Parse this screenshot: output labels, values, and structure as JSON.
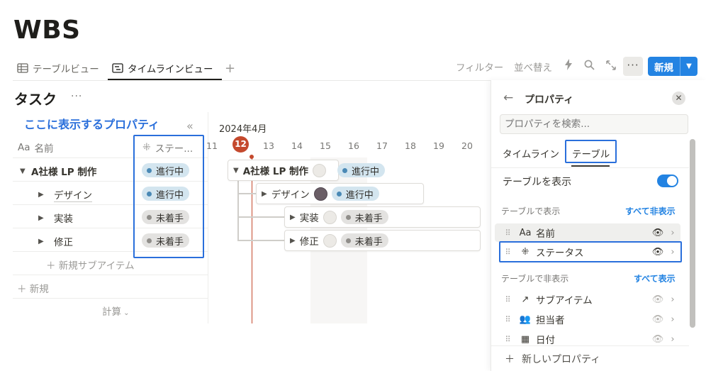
{
  "page": {
    "title": "WBS"
  },
  "views": {
    "tabs": [
      {
        "label": "テーブルビュー",
        "icon": "table-icon"
      },
      {
        "label": "タイムラインビュー",
        "icon": "timeline-icon"
      }
    ],
    "add_label": "+"
  },
  "toolbar": {
    "filter": "フィルター",
    "sort": "並べ替え",
    "more": "···",
    "new": "新規"
  },
  "section": {
    "title": "タスク",
    "dots": "···"
  },
  "annotation": "ここに表示するプロパティ",
  "table": {
    "headers": {
      "name": "名前",
      "name_prefix": "Aa",
      "status": "ステー..."
    },
    "rows": [
      {
        "name": "A社様 LP 制作",
        "status": "進行中"
      },
      {
        "name": "デザイン",
        "status": "進行中"
      },
      {
        "name": "実装",
        "status": "未着手"
      },
      {
        "name": "修正",
        "status": "未着手"
      }
    ],
    "new_subitem": "新規サブアイテム",
    "new_row": "新規",
    "calc": "計算"
  },
  "timeline": {
    "month": "2024年4月",
    "days": [
      "11",
      "12",
      "13",
      "14",
      "15",
      "16",
      "17",
      "18",
      "19",
      "20"
    ],
    "today": "12",
    "bars": [
      {
        "name": "A社様 LP 制作",
        "status": "進行中"
      },
      {
        "name": "デザイン",
        "status": "進行中"
      },
      {
        "name": "実装",
        "status": "未着手"
      },
      {
        "name": "修正",
        "status": "未着手"
      }
    ]
  },
  "panel": {
    "title": "プロパティ",
    "search_placeholder": "プロパティを検索...",
    "tabs": [
      "タイムライン",
      "テーブル"
    ],
    "show_table": "テーブルを表示",
    "visible_group": "テーブルで表示",
    "hide_all": "すべて非表示",
    "visible_props": [
      {
        "name": "名前",
        "icon": "Aa"
      },
      {
        "name": "ステータス",
        "icon": "status-icon"
      }
    ],
    "hidden_group": "テーブルで非表示",
    "show_all": "すべて表示",
    "hidden_props": [
      {
        "name": "サブアイテム",
        "icon": "arrow-icon"
      },
      {
        "name": "担当者",
        "icon": "people-icon"
      },
      {
        "name": "日付",
        "icon": "calendar-icon"
      }
    ],
    "new_property": "新しいプロパティ"
  },
  "colors": {
    "accent": "#2383e2",
    "highlight": "#2a6fdb",
    "today": "#c4492d",
    "in_progress": "#d3e5ef",
    "not_started": "#e3e2e0"
  }
}
